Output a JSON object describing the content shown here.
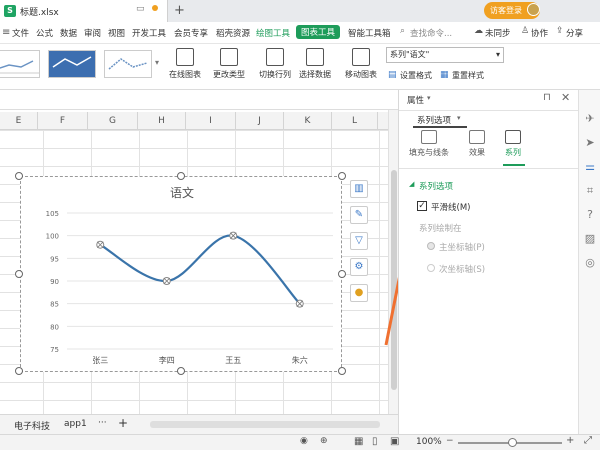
{
  "titlebar": {
    "filename": "标题.xlsx",
    "new_tab": "+",
    "visitor": "访客登录"
  },
  "menu": {
    "items": [
      "文件",
      "公式",
      "数据",
      "审阅",
      "视图",
      "开发工具",
      "会员专享",
      "稻壳资源"
    ],
    "draw_tools": "绘图工具",
    "chart_tools": "图表工具",
    "smart_toolbox": "智能工具箱",
    "search": "查找命令...",
    "unsync": "未同步",
    "collab": "协作",
    "share": "分享"
  },
  "ribbon": {
    "online_chart": "在线图表",
    "change_type": "更改类型",
    "switch_rowcol": "切换行列",
    "select_data": "选择数据",
    "move_chart": "移动图表",
    "series_select": "系列\"语文\"",
    "set_format": "设置格式",
    "reset_style": "重置样式"
  },
  "sheet": {
    "columns": [
      "E",
      "F",
      "G",
      "H",
      "I",
      "J",
      "K",
      "L"
    ],
    "tabs": [
      "电子科技",
      "app1"
    ],
    "more": "···",
    "add": "+"
  },
  "chart_data": {
    "type": "line",
    "title": "语文",
    "categories": [
      "张三",
      "李四",
      "王五",
      "朱六"
    ],
    "series": [
      {
        "name": "语文",
        "values": [
          98,
          90,
          100,
          85
        ],
        "color": "#3a74aa",
        "smooth": true
      }
    ],
    "ylim": [
      75,
      105
    ],
    "yticks": [
      "105",
      "100",
      "95",
      "90",
      "85",
      "80",
      "75"
    ],
    "grid": true
  },
  "panel": {
    "title": "属性",
    "tab": "系列选项",
    "subtabs": [
      "填充与线条",
      "效果",
      "系列"
    ],
    "section": "系列选项",
    "smooth_label": "平滑线(M)",
    "plot_on": "系列绘制在",
    "primary_axis": "主坐标轴(P)",
    "secondary_axis": "次坐标轴(S)"
  },
  "status": {
    "zoom": "100%"
  },
  "colors": {
    "accent": "#1e9c5a",
    "arrow": "#f07030",
    "line": "#3a74aa"
  }
}
